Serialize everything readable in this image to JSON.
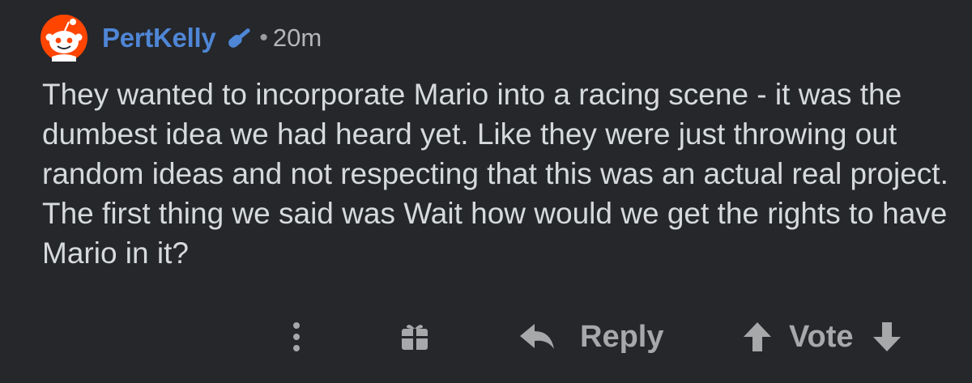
{
  "comment": {
    "author": "PertKelly",
    "separator": "•",
    "time_ago": "20m",
    "body": "They wanted to incorporate Mario into a racing scene - it was the dumbest idea we had heard yet. Like they were just throwing out random ideas and not respecting that this was an actual real project. The first thing we said was Wait how would we get the rights to have Mario in it?"
  },
  "actions": {
    "more_icon": "vertical-ellipsis-icon",
    "gift_icon": "gift-icon",
    "reply_label": "Reply",
    "vote_label": "Vote"
  },
  "colors": {
    "background": "#25272b",
    "username": "#4f86d6",
    "body_text": "#d7dadc",
    "muted": "#a6a8aa",
    "avatar_orange": "#ff4500"
  }
}
